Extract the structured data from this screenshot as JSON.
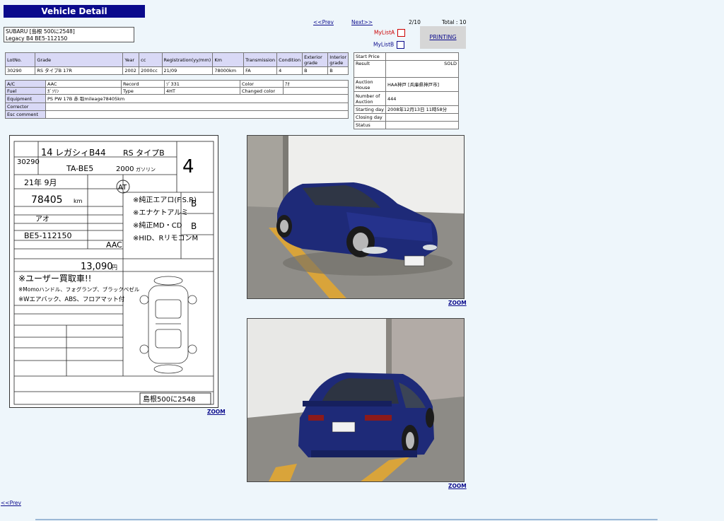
{
  "header": {
    "title": "Vehicle Detail"
  },
  "vehicle": {
    "line1": "SUBARU [島根 500に2548]",
    "line2": "Legacy B4    BE5-112150"
  },
  "nav": {
    "prev": "<<Prev",
    "next": "Next>>",
    "page": "2/10",
    "total": "Total : 10",
    "bottom_prev": "<<Prev"
  },
  "mylist": {
    "a": "MyListA",
    "b": "MyListB",
    "a_color": "#cc0000",
    "b_color": "#0a0a8c"
  },
  "print": {
    "label": "PRINTING"
  },
  "specs": {
    "headers": [
      "LotNo.",
      "Grade",
      "Year",
      "cc",
      "Registration(yy/mm)",
      "Km",
      "Transmission",
      "Condition",
      "Exterior grade",
      "Interior grade"
    ],
    "values": [
      "30290",
      "RS タイプB 17R",
      "2002",
      "2000cc",
      "21/09",
      "78000km",
      "FA",
      "4",
      "B",
      "B"
    ]
  },
  "details": {
    "ac_label": "A/C",
    "ac_value": "AAC",
    "record_label": "Record",
    "record_value": "ｿﾞ331",
    "color_label": "Color",
    "color_value": "ｱｵ",
    "fuel_label": "Fuel",
    "fuel_value": "ｶﾞｿﾘﾝ",
    "type_label": "Type",
    "type_value": "4HT",
    "changed_color_label": "Changed color",
    "changed_color_value": "",
    "equipment_label": "Equipment",
    "equipment_value": "PS PW 17B 赤 取mileage78405km",
    "corrector_label": "Corrector",
    "corrector_value": "",
    "comment_label": "Esc comment",
    "comment_value": ""
  },
  "auction": {
    "start_price_label": "Start Price",
    "start_price_value": "",
    "result_label": "Result",
    "result_value": "SOLD",
    "house_label": "Auction House",
    "house_value": "HAA神戸 [兵庫県神戸市]",
    "number_label": "Number of Auction",
    "number_value": "444",
    "starting_label": "Starting day",
    "starting_value": "2008年12月13日 11時58分",
    "closing_label": "Closing day",
    "closing_value": "",
    "status_label": "Status",
    "status_value": ""
  },
  "sheet": {
    "lot": "30290",
    "year": "14",
    "model": "レガシィB4",
    "doors": "4",
    "grade": "RS タイプB",
    "code": "TA-BE5",
    "cc": "2000",
    "fuel": "ガソリン",
    "shaken": "21年 9月",
    "km": "78405",
    "km_unit": "km",
    "at": "AT",
    "color": "アオ",
    "frame": "BE5-112150",
    "score": "4",
    "int": "B",
    "ext": "B",
    "points": [
      "※純正エアロ(F.S.R)",
      "※エナケトアルミ",
      "※純正MD・CD",
      "※HID、RリモコンM"
    ],
    "recycle": "13,090",
    "recycle_unit": "円",
    "note1": "※ユーザー買取車!!",
    "note2": "※Momoハンドル、フォグランプ、ブラックベゼル",
    "note3": "※Wエアバック、ABS、フロアマット付",
    "plate": "島根500に2548",
    "ac": "AAC"
  },
  "zoom": {
    "label": "ZOOM"
  },
  "photos": {
    "front": "Blue Subaru Legacy B4 front three-quarter view",
    "rear": "Blue Subaru Legacy B4 rear three-quarter view"
  }
}
